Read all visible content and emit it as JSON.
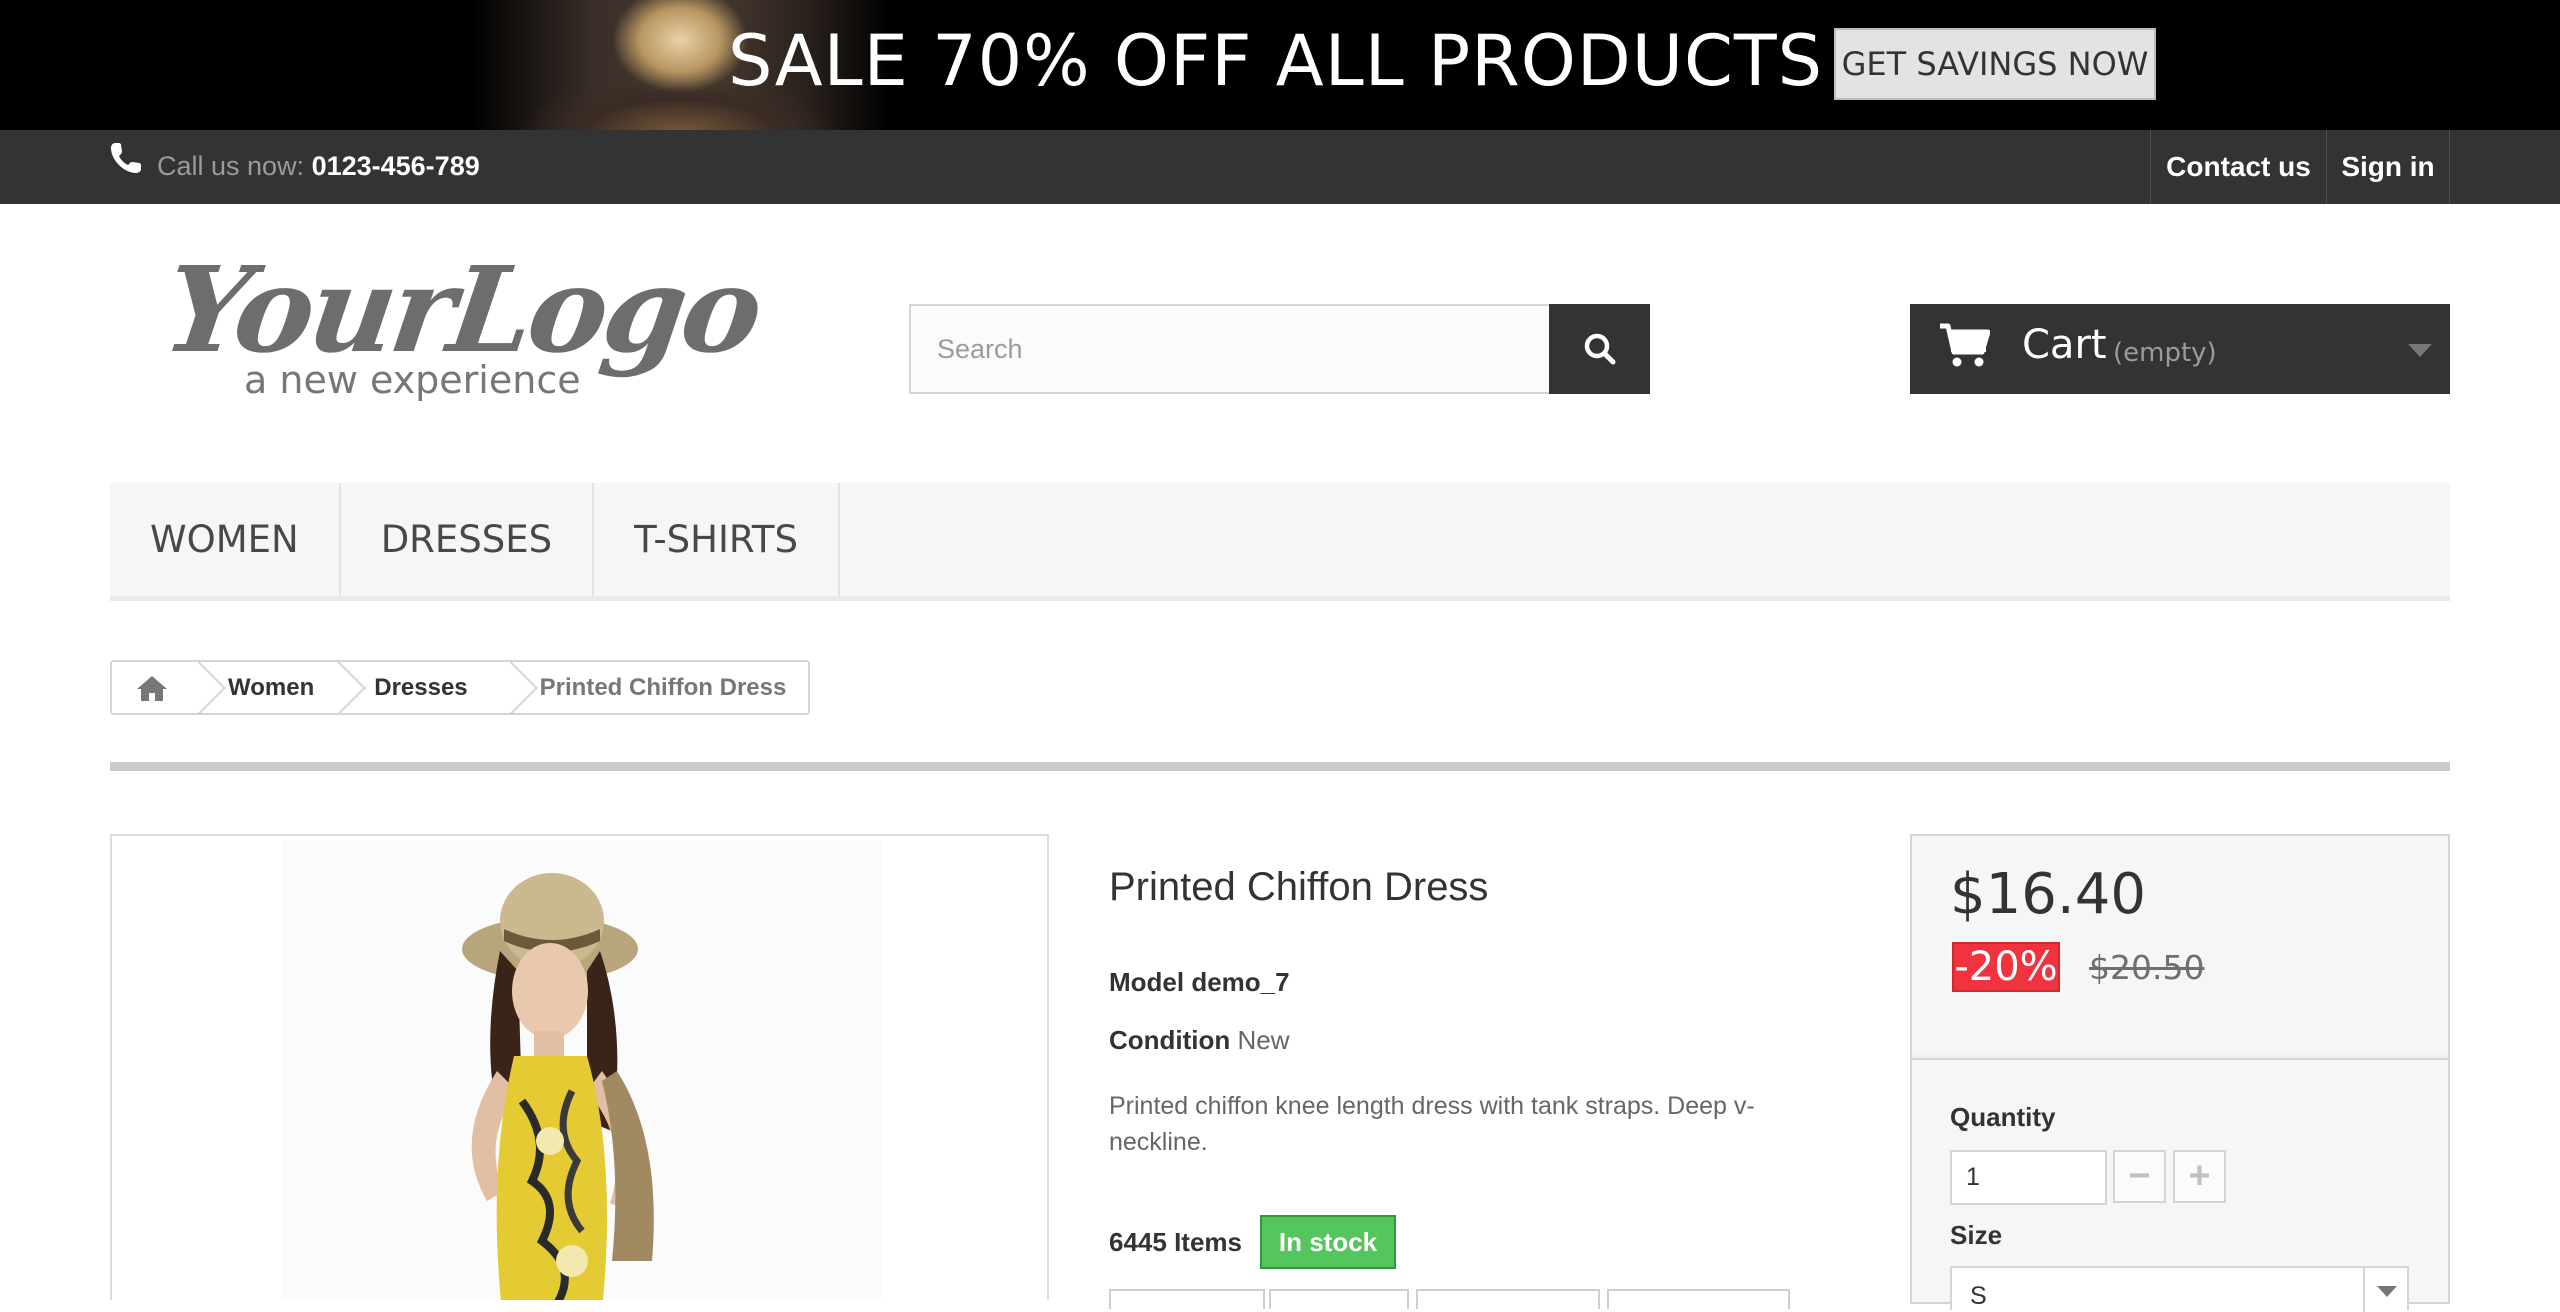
{
  "banner": {
    "headline": "SALE 70% OFF ALL PRODUCTS",
    "cta_label": "GET SAVINGS NOW"
  },
  "topbar": {
    "call_label": "Call us now: ",
    "phone_number": "0123-456-789",
    "contact_label": "Contact us",
    "signin_label": "Sign in"
  },
  "header": {
    "logo_text": "YourLogo",
    "logo_tagline": "a new experience",
    "search_placeholder": "Search",
    "search_value": "",
    "cart_label": "Cart",
    "cart_status": "(empty)"
  },
  "menu": {
    "items": [
      {
        "label": "WOMEN"
      },
      {
        "label": "DRESSES"
      },
      {
        "label": "T-SHIRTS"
      }
    ]
  },
  "breadcrumb": {
    "items": [
      "Women",
      "Dresses"
    ],
    "current": "Printed Chiffon Dress"
  },
  "product": {
    "title": "Printed Chiffon Dress",
    "model_label": "Model",
    "model_value": "demo_7",
    "condition_label": "Condition",
    "condition_value": "New",
    "description": "Printed chiffon knee length dress with tank straps. Deep v-neckline.",
    "items_count": "6445 Items",
    "stock_status": "In stock"
  },
  "pricebox": {
    "price": "$16.40",
    "discount": "-20%",
    "old_price": "$20.50",
    "quantity_label": "Quantity",
    "quantity_value": "1",
    "minus_symbol": "−",
    "plus_symbol": "+",
    "size_label": "Size",
    "size_value": "S"
  },
  "colors": {
    "topbar_bg": "#333333",
    "stock_green": "#55c65e",
    "discount_red": "#f13340"
  }
}
